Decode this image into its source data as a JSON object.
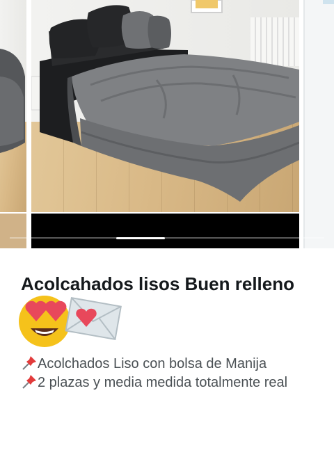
{
  "product": {
    "title": "Acolcahados lisos Buen relleno",
    "emojis": [
      "heart-eyes-emoji",
      "love-letter-emoji"
    ],
    "description": [
      {
        "icon": "pushpin-icon",
        "text": "Acolchados Liso con bolsa de Manija"
      },
      {
        "icon": "pushpin-icon",
        "text": "2 plazas y media medida totalmente real"
      }
    ]
  },
  "gallery": {
    "images": [
      "bed-photo-previous",
      "bed-photo-gray-comforter",
      "bed-photo-next"
    ],
    "progress": 0.5
  },
  "colors": {
    "comforter": "#7b7d80",
    "sheets": "#1d1e20",
    "floor": "#d9b987",
    "title_text": "#15191c",
    "body_text": "#4a5054"
  }
}
